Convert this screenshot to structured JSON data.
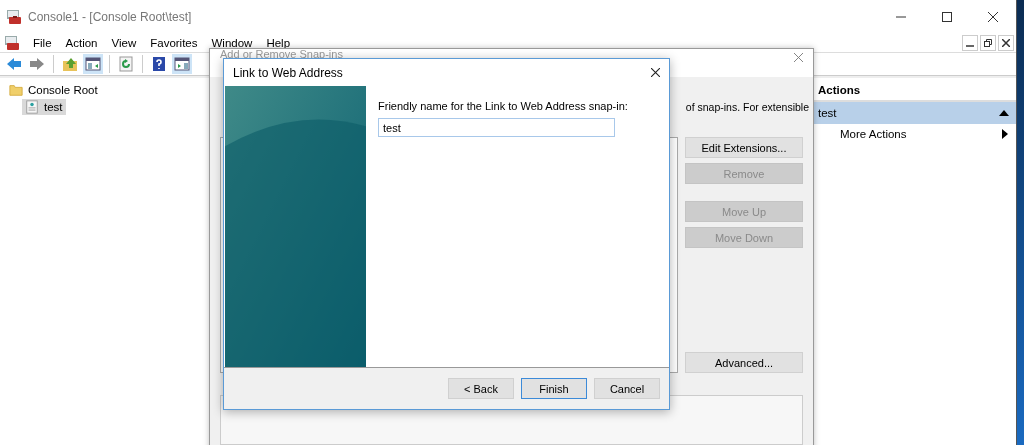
{
  "window": {
    "title": "Console1 - [Console Root\\test]"
  },
  "menu": [
    "File",
    "Action",
    "View",
    "Favorites",
    "Window",
    "Help"
  ],
  "toolbar": [
    {
      "kind": "back",
      "pressed": false
    },
    {
      "kind": "forward",
      "pressed": false
    },
    {
      "kind": "up",
      "pressed": false
    },
    {
      "kind": "tree",
      "pressed": true
    },
    {
      "kind": "refresh",
      "pressed": false
    },
    {
      "kind": "help",
      "pressed": false
    },
    {
      "kind": "actionpane",
      "pressed": true
    }
  ],
  "tree": [
    {
      "label": "Console Root",
      "kind": "folder",
      "selected": false,
      "children": [
        {
          "label": "test",
          "kind": "page",
          "selected": true
        }
      ]
    }
  ],
  "actions": {
    "header": "Actions",
    "groups": [
      {
        "title": "test",
        "expanded": true,
        "items": [
          {
            "label": "More Actions",
            "submenu": true
          }
        ]
      }
    ]
  },
  "snapin_dialog": {
    "title": "Add or Remove Snap-ins",
    "intro_fragment": "of snap-ins. For extensible",
    "button_groups": [
      [
        {
          "label": "Edit Extensions...",
          "disabled": false
        },
        {
          "label": "Remove",
          "disabled": true
        }
      ],
      [
        {
          "label": "Move Up",
          "disabled": true
        },
        {
          "label": "Move Down",
          "disabled": true
        }
      ]
    ],
    "advanced_button": {
      "label": "Advanced...",
      "disabled": false
    }
  },
  "link_dialog": {
    "title": "Link to Web Address",
    "field_label": "Friendly name for the Link to Web Address snap-in:",
    "field_value": "test",
    "buttons": [
      {
        "label": "< Back",
        "default": false
      },
      {
        "label": "Finish",
        "default": true
      },
      {
        "label": "Cancel",
        "default": false
      }
    ]
  }
}
